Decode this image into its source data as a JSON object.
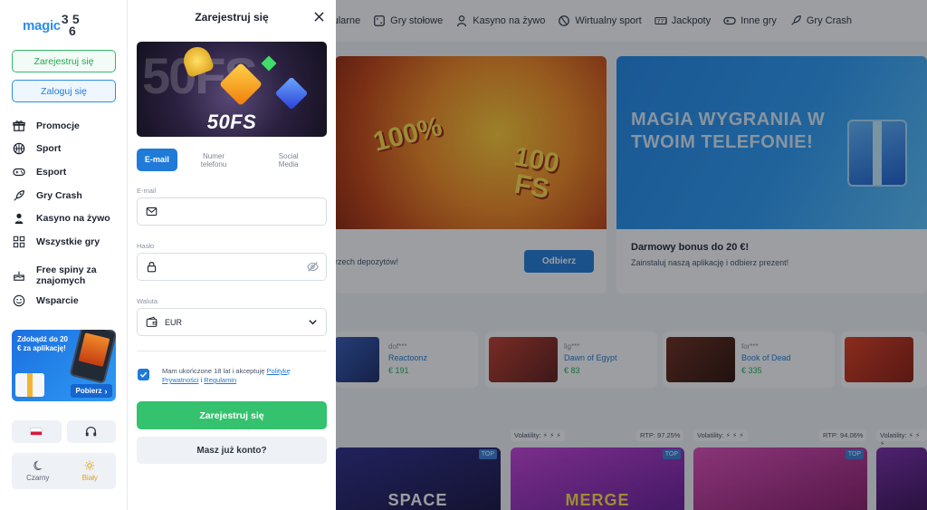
{
  "logo": {
    "word": "magic",
    "digits": [
      "3",
      "6",
      "5"
    ]
  },
  "sidebar": {
    "register_label": "Zarejestruj się",
    "login_label": "Zaloguj się",
    "items": [
      {
        "label": "Promocje",
        "icon": "gift-icon"
      },
      {
        "label": "Sport",
        "icon": "basketball-icon"
      },
      {
        "label": "Esport",
        "icon": "gamepad-icon"
      },
      {
        "label": "Gry Crash",
        "icon": "rocket-icon"
      },
      {
        "label": "Kasyno na żywo",
        "icon": "dealer-icon"
      },
      {
        "label": "Wszystkie gry",
        "icon": "grid-icon"
      },
      {
        "label": "Free spiny za znajomych",
        "icon": "cake-icon"
      },
      {
        "label": "Wsparcie",
        "icon": "smile-icon"
      }
    ],
    "app_banner": {
      "text": "Zdobądź do 20 € za aplikację!",
      "button": "Pobierz"
    },
    "theme": {
      "dark": "Czarny",
      "light": "Biały",
      "selected": "Biały"
    }
  },
  "register_panel": {
    "title": "Zarejestruj się",
    "hero_label": "50FS",
    "hero_back": "50FS",
    "tabs": [
      {
        "label": "E-mail",
        "active": true
      },
      {
        "label": "Numer telefonu",
        "active": false
      },
      {
        "label": "Social Media",
        "active": false
      }
    ],
    "email_label": "E-mail",
    "email_value": "",
    "password_label": "Hasło",
    "password_value": "",
    "currency_label": "Waluta",
    "currency_value": "EUR",
    "consent": {
      "prefix": "Mam ukończone 18 lat i akceptuję",
      "privacy_link": "Politykę Prywatności",
      "joiner": "i",
      "terms_link": "Regulamin",
      "checked": true
    },
    "submit_label": "Zarejestruj się",
    "have_account_label": "Masz już konto?"
  },
  "background": {
    "nav": [
      {
        "label": "Popularne",
        "icon": "star-icon"
      },
      {
        "label": "Gry stołowe",
        "icon": "dice-icon"
      },
      {
        "label": "Kasyno na żywo",
        "icon": "dealer-icon"
      },
      {
        "label": "Wirtualny sport",
        "icon": "football-icon"
      },
      {
        "label": "Jackpoty",
        "icon": "sevens-icon"
      },
      {
        "label": "Inne gry",
        "icon": "gamepad-icon"
      },
      {
        "label": "Gry Crash",
        "icon": "rocket-icon"
      }
    ],
    "promo1": {
      "art_percent": "100%",
      "art_fs": "100 FS",
      "desc": "rzech depozytów!",
      "button": "Odbierz"
    },
    "promo2": {
      "headline": "MAGIA WYGRANIA W TWOIM TELEFONIE!",
      "title": "Darmowy bonus do 20 €!",
      "sub": "Zainstaluj naszą aplikację i odbierz prezent!"
    },
    "wins": [
      {
        "user": "dof***",
        "game": "Reactoonz",
        "amount": "€ 191"
      },
      {
        "user": "lig***",
        "game": "Dawn of Egypt",
        "amount": "€ 83"
      },
      {
        "user": "for***",
        "game": "Book of Dead",
        "amount": "€ 335"
      }
    ],
    "tags": [
      {
        "text": "Volatility: ⚡ ⚡ ⚡"
      },
      {
        "text": "RTP: 97.25%"
      },
      {
        "text": "Volatility: ⚡ ⚡ ⚡"
      },
      {
        "text": "RTP: 94.06%"
      },
      {
        "text": "Volatility: ⚡ ⚡ ⚡"
      }
    ],
    "tiles": [
      {
        "name": "SPACE",
        "badge": "TOP"
      },
      {
        "name": "MERGE",
        "badge": "TOP"
      },
      {
        "name": "",
        "badge": "TOP"
      }
    ]
  }
}
